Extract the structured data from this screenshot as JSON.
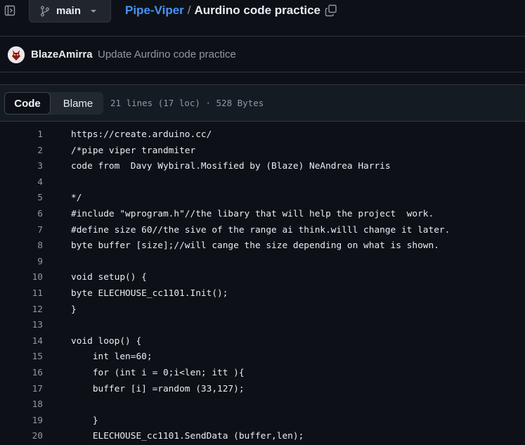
{
  "topbar": {
    "sidebar_toggle_icon": "sidebar-expand-icon",
    "branch": "main",
    "repo": "Pipe-Viper",
    "separator": "/",
    "file_name": "Aurdino code practice",
    "copy_icon": "copy-icon"
  },
  "commit": {
    "author": "BlazeAmirra",
    "message": "Update Aurdino code practice"
  },
  "file_header": {
    "tabs": [
      "Code",
      "Blame"
    ],
    "active_tab": "Code",
    "info": "21 lines (17 loc) · 528 Bytes"
  },
  "code": {
    "lines": [
      {
        "n": "1",
        "text": "https://create.arduino.cc/"
      },
      {
        "n": "2",
        "text": "/*pipe viper trandmiter"
      },
      {
        "n": "3",
        "text": "code from  Davy Wybiral.Mosified by (Blaze) NeAndrea Harris"
      },
      {
        "n": "4",
        "text": ""
      },
      {
        "n": "5",
        "text": "*/"
      },
      {
        "n": "6",
        "text": "#include \"wprogram.h\"//the libary that will help the project  work."
      },
      {
        "n": "7",
        "text": "#define size 60//the sive of the range ai think.willl change it later."
      },
      {
        "n": "8",
        "text": "byte buffer [size];//will cange the size depending on what is shown."
      },
      {
        "n": "9",
        "text": ""
      },
      {
        "n": "10",
        "text": "void setup() {"
      },
      {
        "n": "11",
        "text": "byte ELECHOUSE_cc1101.Init();"
      },
      {
        "n": "12",
        "text": "}"
      },
      {
        "n": "13",
        "text": ""
      },
      {
        "n": "14",
        "text": "void loop() {"
      },
      {
        "n": "15",
        "text": "    int len=60;"
      },
      {
        "n": "16",
        "text": "    for (int i = 0;i<len; itt ){"
      },
      {
        "n": "17",
        "text": "    buffer [i] =random (33,127);"
      },
      {
        "n": "18",
        "text": ""
      },
      {
        "n": "19",
        "text": "    }"
      },
      {
        "n": "20",
        "text": "    ELECHOUSE_cc1101.SendData (buffer,len);"
      }
    ]
  }
}
